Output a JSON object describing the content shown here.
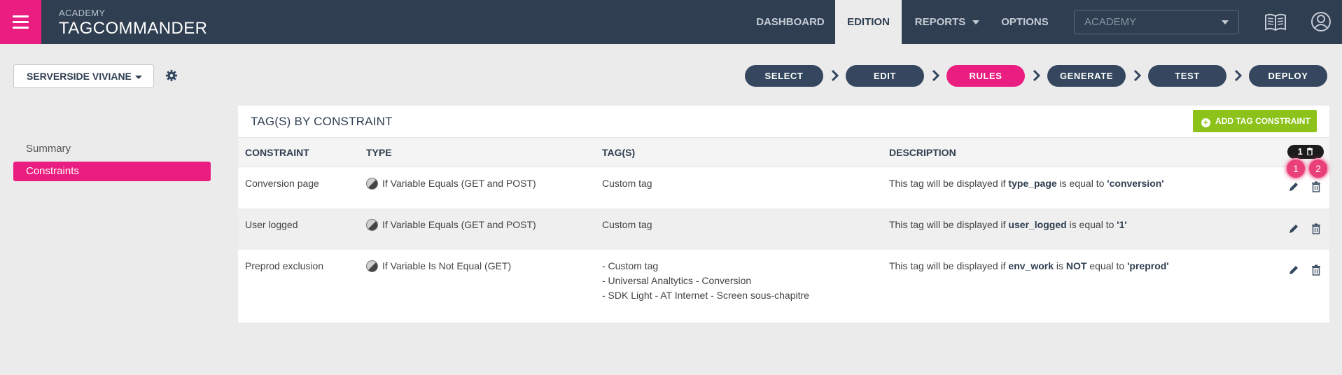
{
  "header": {
    "brand_sub": "ACADEMY",
    "brand_main": "TAGCOMMANDER",
    "nav": [
      {
        "label": "DASHBOARD"
      },
      {
        "label": "EDITION"
      },
      {
        "label": "REPORTS"
      },
      {
        "label": "OPTIONS"
      }
    ],
    "account_select": "ACADEMY"
  },
  "toolbar": {
    "container_label": "SERVERSIDE VIVIANE",
    "steps": [
      {
        "label": "SELECT"
      },
      {
        "label": "EDIT"
      },
      {
        "label": "RULES"
      },
      {
        "label": "GENERATE"
      },
      {
        "label": "TEST"
      },
      {
        "label": "DEPLOY"
      }
    ]
  },
  "sidebar": {
    "items": [
      {
        "label": "Summary"
      },
      {
        "label": "Constraints"
      }
    ]
  },
  "panel": {
    "title": "TAG(S) BY CONSTRAINT",
    "add_button": "ADD TAG CONSTRAINT",
    "columns": [
      "CONSTRAINT",
      "TYPE",
      "TAG(S)",
      "DESCRIPTION"
    ],
    "count_badge": "1",
    "rows": [
      {
        "constraint": "Conversion page",
        "type": "If Variable Equals (GET and POST)",
        "tags": [
          "Custom tag"
        ],
        "desc": {
          "pre": "This tag will be displayed if ",
          "var": "type_page",
          "mid": " is equal to ",
          "neg": "",
          "mid2": "",
          "value": "'conversion'"
        }
      },
      {
        "constraint": "User logged",
        "type": "If Variable Equals (GET and POST)",
        "tags": [
          "Custom tag"
        ],
        "desc": {
          "pre": "This tag will be displayed if ",
          "var": "user_logged",
          "mid": " is equal to ",
          "neg": "",
          "mid2": "",
          "value": "'1'"
        }
      },
      {
        "constraint": "Preprod exclusion",
        "type": "If Variable Is Not Equal (GET)",
        "tags": [
          "- Custom tag",
          "- Universal Analtytics - Conversion",
          "- SDK Light - AT Internet - Screen sous-chapitre"
        ],
        "desc": {
          "pre": "This tag will be displayed if ",
          "var": "env_work",
          "mid": " is ",
          "neg": "NOT",
          "mid2": " equal to ",
          "value": "'preprod'"
        }
      }
    ]
  },
  "markers": [
    "1",
    "2"
  ],
  "colors": {
    "topbar": "#2f3e50",
    "accent_pink": "#e91e80",
    "step_default": "#34475e",
    "add_green": "#8cc21a"
  },
  "icons": [
    "menu-icon",
    "book-icon",
    "user-icon",
    "gear-icon",
    "chevron-right-icon",
    "plus-circle-icon",
    "trash-icon",
    "pencil-icon",
    "variable-type-icon"
  ]
}
